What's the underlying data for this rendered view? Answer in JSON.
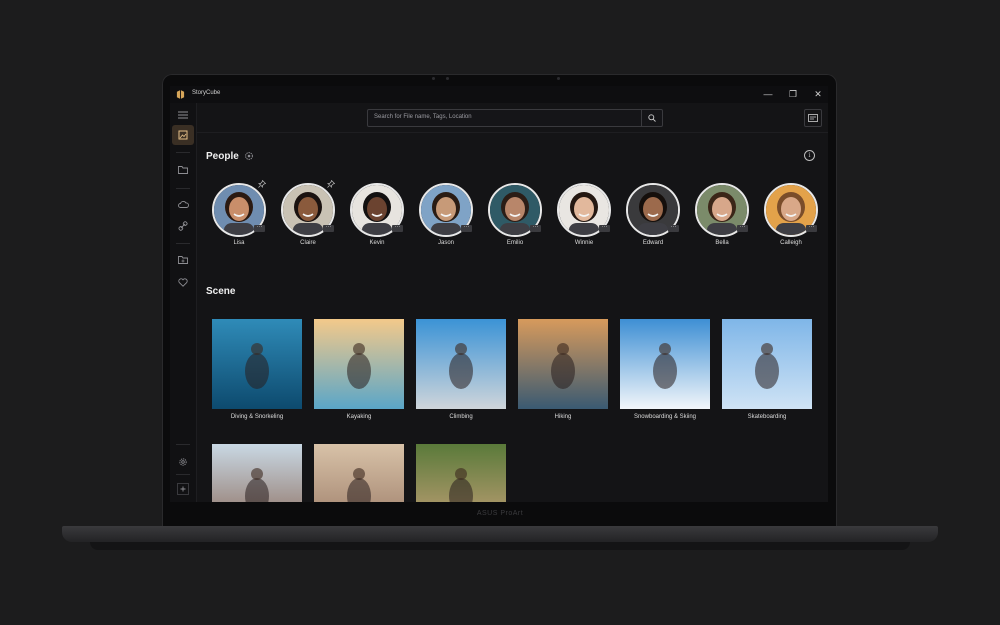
{
  "device": {
    "brand": "ASUS ProArt"
  },
  "app": {
    "title": "StoryCube"
  },
  "window": {
    "minimize": "—",
    "restore": "❐",
    "close": "✕"
  },
  "search": {
    "placeholder": "Search for File name, Tags, Location"
  },
  "sidebar": {
    "items": [
      {
        "icon": "menu-icon"
      },
      {
        "icon": "gallery-icon",
        "active": true
      },
      {
        "icon": "folder-icon"
      },
      {
        "icon": "cloud-icon"
      },
      {
        "icon": "link-icon"
      },
      {
        "icon": "folder-plus-icon"
      },
      {
        "icon": "heart-icon"
      },
      {
        "icon": "settings-icon"
      },
      {
        "icon": "add-icon"
      }
    ]
  },
  "people": {
    "title": "People",
    "items": [
      {
        "name": "Lisa",
        "skin": "#c98e6a",
        "hair": "#2b1a12",
        "bg": "#6f8db0",
        "pinned": true
      },
      {
        "name": "Claire",
        "skin": "#8a5a3c",
        "hair": "#1a1210",
        "bg": "#c9c2b4",
        "pinned": true
      },
      {
        "name": "Kevin",
        "skin": "#6b4330",
        "hair": "#121010",
        "bg": "#e7e4df",
        "pinned": false
      },
      {
        "name": "Jason",
        "skin": "#c79a78",
        "hair": "#2a1c14",
        "bg": "#7fa3c6",
        "pinned": false
      },
      {
        "name": "Emilio",
        "skin": "#b8866a",
        "hair": "#2b1d16",
        "bg": "#2f5a66",
        "pinned": false
      },
      {
        "name": "Winnie",
        "skin": "#e2b89c",
        "hair": "#241812",
        "bg": "#e9e6e2",
        "pinned": false
      },
      {
        "name": "Edward",
        "skin": "#9c6a4c",
        "hair": "#150f0c",
        "bg": "#3a3a3c",
        "pinned": false
      },
      {
        "name": "Bella",
        "skin": "#d7a78a",
        "hair": "#3b2618",
        "bg": "#7b8b6a",
        "pinned": false
      },
      {
        "name": "Calleigh",
        "skin": "#d9a888",
        "hair": "#7a4d2a",
        "bg": "#e3a24a",
        "pinned": false
      }
    ],
    "more_label": "···",
    "pin_glyph": "📌"
  },
  "scene": {
    "title": "Scene",
    "items": [
      {
        "label": "Diving & Snorkeling",
        "top": "#2f8bb8",
        "bottom": "#0d4a6e"
      },
      {
        "label": "Kayaking",
        "top": "#f3c98a",
        "bottom": "#5aa6c8"
      },
      {
        "label": "Climbing",
        "top": "#3b93d6",
        "bottom": "#cfd5da"
      },
      {
        "label": "Hiking",
        "top": "#d79a5c",
        "bottom": "#3a5a72"
      },
      {
        "label": "Snowboarding & Skiing",
        "top": "#3e8fd4",
        "bottom": "#f2f6fa"
      },
      {
        "label": "Skateboarding",
        "top": "#7fb6e8",
        "bottom": "#cfe3f5"
      },
      {
        "label": "",
        "top": "#c9d8e4",
        "bottom": "#8a6a5a"
      },
      {
        "label": "",
        "top": "#d8c2a8",
        "bottom": "#9a7a66"
      },
      {
        "label": "",
        "top": "#5a7a3a",
        "bottom": "#c9a27a"
      }
    ]
  },
  "colors": {
    "accent": "#e7c28a",
    "active_bg": "#3a2f24"
  }
}
